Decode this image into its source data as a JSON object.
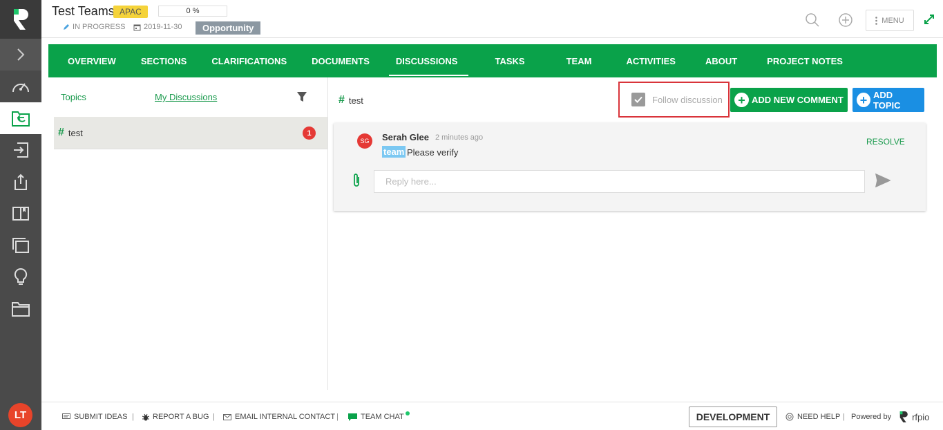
{
  "project": {
    "title": "Test Teams",
    "region": "APAC",
    "progress_text": "0 %",
    "progress_value": 0,
    "status": "IN PROGRESS",
    "due_date": "2019-11-30",
    "type": "Opportunity"
  },
  "header": {
    "menu_label": "MENU"
  },
  "user": {
    "initials": "LT"
  },
  "tabs": [
    {
      "label": "OVERVIEW"
    },
    {
      "label": "SECTIONS"
    },
    {
      "label": "CLARIFICATIONS"
    },
    {
      "label": "DOCUMENTS"
    },
    {
      "label": "DISCUSSIONS",
      "active": true
    },
    {
      "label": "TASKS"
    },
    {
      "label": "TEAM"
    },
    {
      "label": "ACTIVITIES"
    },
    {
      "label": "ABOUT"
    },
    {
      "label": "PROJECT NOTES"
    }
  ],
  "left_pane": {
    "tab_topics": "Topics",
    "tab_my_discussions": "My Discussions",
    "topics": [
      {
        "name": "test",
        "unread": "1"
      }
    ]
  },
  "discussion": {
    "topic": "test",
    "follow_label": "Follow discussion",
    "follow_checked": true,
    "add_comment_label": "ADD NEW COMMENT",
    "add_topic_label": "ADD TOPIC",
    "comment": {
      "author_initials": "SG",
      "author": "Serah Glee",
      "time": "2 minutes ago",
      "mention": "team",
      "text": "Please verify",
      "resolve_label": "RESOLVE"
    },
    "reply_placeholder": "Reply here..."
  },
  "footer": {
    "submit_ideas": "SUBMIT IDEAS",
    "report_bug": "REPORT A BUG",
    "email_contact": "EMAIL INTERNAL CONTACT",
    "team_chat": "TEAM CHAT",
    "environment": "DEVELOPMENT",
    "need_help": "NEED HELP",
    "powered_by": "Powered by",
    "brand": "rfpio"
  },
  "colors": {
    "brand_green": "#0aa24a",
    "accent_blue": "#1a8fe3",
    "alert_red": "#e53935",
    "region_yellow": "#f5d33a",
    "rail_dark": "#4a4a4a"
  }
}
